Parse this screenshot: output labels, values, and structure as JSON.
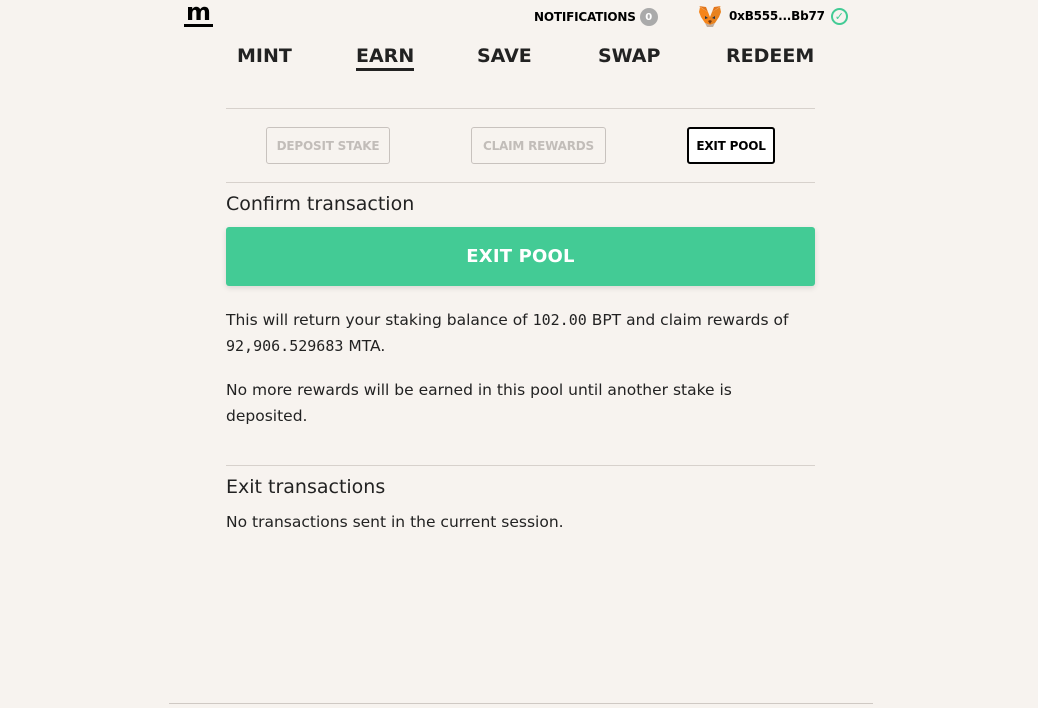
{
  "header": {
    "logo_text": "m",
    "notifications_label": "NOTIFICATIONS",
    "notifications_count": "0",
    "account_address": "0xB555...Bb77",
    "wallet_icon": "metamask-fox-icon",
    "status_icon": "check-circle-icon"
  },
  "nav": {
    "tabs": [
      {
        "label": "MINT",
        "active": false
      },
      {
        "label": "EARN",
        "active": true
      },
      {
        "label": "SAVE",
        "active": false
      },
      {
        "label": "SWAP",
        "active": false
      },
      {
        "label": "REDEEM",
        "active": false
      }
    ]
  },
  "subtabs": [
    {
      "label": "DEPOSIT STAKE",
      "active": false
    },
    {
      "label": "CLAIM REWARDS",
      "active": false
    },
    {
      "label": "EXIT POOL",
      "active": true
    }
  ],
  "confirm": {
    "heading": "Confirm transaction",
    "button_label": "EXIT POOL",
    "sentence_prefix": "This will return your staking balance of",
    "staking_balance": "102.00",
    "sentence_middle": "BPT and claim rewards of",
    "rewards_amount": "92,906.529683",
    "sentence_suffix": "MTA.",
    "note": "No more rewards will be earned in this pool until another stake is deposited."
  },
  "exit_transactions": {
    "heading": "Exit transactions",
    "empty_text": "No transactions sent in the current session."
  },
  "colors": {
    "background": "#f7f3ef",
    "accent_green": "#43cb95",
    "text": "#222222",
    "muted": "#c2bdb9"
  }
}
